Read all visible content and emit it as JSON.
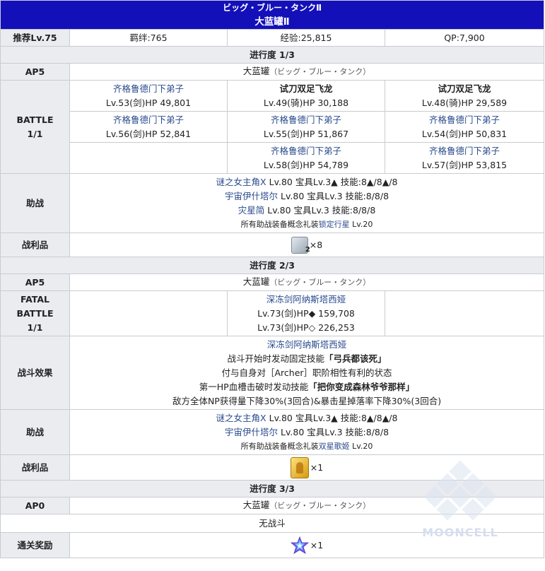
{
  "header": {
    "title_jp": "ビッグ・ブルー・タンクⅡ",
    "title_cn": "大蓝罐Ⅱ"
  },
  "summary": {
    "level_label": "推荐Lv.75",
    "bond": "羁绊:765",
    "exp": "经验:25,815",
    "qp": "QP:7,900"
  },
  "sections": [
    {
      "progress": "进行度 1/3",
      "ap_label": "AP5",
      "location": "大蓝罐",
      "location_kana": "（ビッグ・ブルー・タンク）",
      "battle_label_1": "BATTLE",
      "battle_label_2": "1/1",
      "enemies": [
        {
          "name": "齐格鲁德门下弟子",
          "stats": "Lv.53(剑)HP 49,801"
        },
        {
          "name": "试刀双足飞龙",
          "stats": "Lv.49(骑)HP 30,188"
        },
        {
          "name": "试刀双足飞龙",
          "stats": "Lv.48(骑)HP 29,589"
        },
        {
          "name": "齐格鲁德门下弟子",
          "stats": "Lv.56(剑)HP 52,841"
        },
        {
          "name": "齐格鲁德门下弟子",
          "stats": "Lv.55(剑)HP 51,867"
        },
        {
          "name": "齐格鲁德门下弟子",
          "stats": "Lv.54(剑)HP 50,831"
        },
        {
          "name": "齐格鲁德门下弟子",
          "stats": "Lv.58(剑)HP 54,789"
        },
        {
          "name": "齐格鲁德门下弟子",
          "stats": "Lv.57(剑)HP 53,815"
        }
      ],
      "support_label": "助战",
      "support": [
        {
          "name": "谜之女主角X",
          "detail": "Lv.80 宝具Lv.3▲ 技能:8▲/8▲/8"
        },
        {
          "name": "宇宙伊什塔尔",
          "detail": "Lv.80 宝具Lv.3 技能:8/8/8"
        },
        {
          "name": "灾星简",
          "detail": "Lv.80 宝具Lv.3 技能:8/8/8"
        }
      ],
      "support_ce_prefix": "所有助战装备概念礼装",
      "support_ce": "锁定行星",
      "support_ce_suffix": "Lv.20",
      "drops_label": "战利品",
      "drop_icon_sub": "2",
      "drop_qty": "×8"
    },
    {
      "progress": "进行度 2/3",
      "ap_label": "AP5",
      "location": "大蓝罐",
      "location_kana": "（ビッグ・ブルー・タンク）",
      "battle_label_0": "FATAL",
      "battle_label_1": "BATTLE",
      "battle_label_2": "1/1",
      "boss_name": "深冻剑阿纳斯塔西娅",
      "boss_stats_1": "Lv.73(剑)HP◆ 159,708",
      "boss_stats_2": "Lv.73(剑)HP◇ 226,253",
      "effect_label": "战斗效果",
      "effect_name": "深冻剑阿纳斯塔西娅",
      "effect_line1_pre": "战斗开始时发动固定技能",
      "effect_line1_skill": "「弓兵都该死」",
      "effect_line2": "付与自身对［Archer］职阶相性有利的状态",
      "effect_line3_pre": "第一HP血槽击破时发动技能",
      "effect_line3_skill": "「把你变成森林爷爷那样」",
      "effect_line4": "敌方全体NP获得量下降30%(3回合)&暴击星掉落率下降30%(3回合)",
      "support_label": "助战",
      "support": [
        {
          "name": "谜之女主角X",
          "detail": "Lv.80 宝具Lv.3▲ 技能:8▲/8▲/8"
        },
        {
          "name": "宇宙伊什塔尔",
          "detail": "Lv.80 宝具Lv.3 技能:8/8/8"
        }
      ],
      "support_ce_prefix": "所有助战装备概念礼装",
      "support_ce": "双星歌姬",
      "support_ce_suffix": "Lv.20",
      "drops_label": "战利品",
      "drop_qty": "×1"
    },
    {
      "progress": "进行度 3/3",
      "ap_label": "AP0",
      "location": "大蓝罐",
      "location_kana": "（ビッグ・ブルー・タンク）",
      "no_battle": "无战斗",
      "reward_label": "通关奖励",
      "reward_qty": "×1"
    }
  ],
  "watermark": "MOONCELL",
  "icons": [
    "ticket-item-icon",
    "gold-statue-icon",
    "saint-quartz-icon",
    "mooncell-logo"
  ],
  "colors": {
    "header_bg": "#1410b9",
    "label_bg": "#eaecf0",
    "link": "#2a4b8d",
    "border": "#c8ccd1"
  }
}
